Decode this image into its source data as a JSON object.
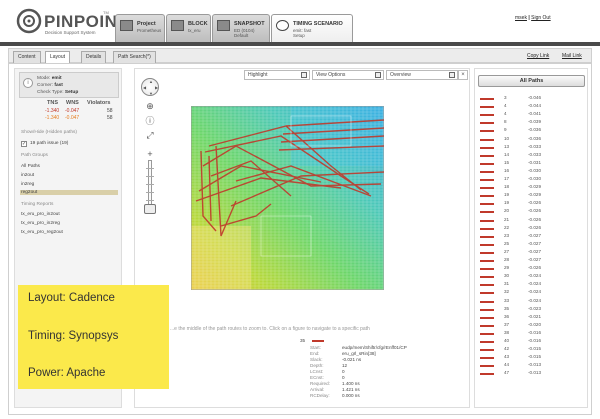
{
  "header": {
    "brand": "PINPOINT",
    "brand_tm": "TM",
    "tagline": "Decision Support System",
    "user": "msek",
    "separator": "|",
    "sign_out": "Sign Out",
    "crumbs": {
      "project": {
        "title": "Project",
        "sub": "Prometheus"
      },
      "block": {
        "title": "BLOCK",
        "sub": "tx_eru"
      },
      "snapshot": {
        "title": "SNAPSHOT",
        "sub": "ED (0104)",
        "sub2": "Default"
      },
      "timing": {
        "title": "TIMING SCENARIO",
        "sub": "emit: fast",
        "sub2": "Setup"
      }
    }
  },
  "tabs": [
    "Content",
    "Layout",
    "Details",
    "Path Search(*)"
  ],
  "active_tab": "Layout",
  "links": {
    "copy": "Copy Link",
    "mail": "Mail Link"
  },
  "left": {
    "mode": {
      "mode_label": "Mode:",
      "mode_value": "emit",
      "corner_label": "Corner:",
      "corner_value": "fast",
      "check_label": "Check Type:",
      "check_value": "Setup"
    },
    "metrics": {
      "headers": [
        "TNS",
        "WNS",
        "Violators"
      ],
      "rows": [
        [
          "-1.340",
          "-0.047",
          "58"
        ],
        [
          "-1.340",
          "-0.047",
          "58"
        ]
      ]
    },
    "hidden_label": "Show/Hide (Hidden paths)",
    "path_issue": "19 path issue (19)",
    "path_groups_label": "Path Groups",
    "path_groups": [
      "All Paths",
      "in2out",
      "in2reg",
      "reg2out"
    ],
    "selected_group": "reg2out",
    "timing_reports_label": "Timing Reports",
    "timing_reports": [
      "tx_eru_pro_in2out",
      "tx_eru_pro_in2reg",
      "tx_eru_pro_reg2out"
    ]
  },
  "overlay": {
    "lines": [
      "Layout: Cadence",
      "Timing: Synopsys",
      "Power: Apache"
    ]
  },
  "toolbar": {
    "highlight": "Highlight",
    "view_options": "View Options",
    "overview": "Overview",
    "close": "×"
  },
  "center": {
    "hint": "...e the middle of the path routes to zoom to. Click on a figure to navigate to a specific path",
    "selected_path_num": "35",
    "details": [
      [
        "Start:",
        "eudp/mem/Shiftr/cfg/rEnff01/CP"
      ],
      [
        "End:",
        "eru_grl_sRin[38]"
      ],
      [
        "Slack:",
        "-0.021 ns"
      ],
      [
        "Depth:",
        "12"
      ],
      [
        "LCnst:",
        "0"
      ],
      [
        "ECnst:",
        "0"
      ],
      [
        "Required:",
        "1.400 ns"
      ],
      [
        "Arrival:",
        "1.421 ns"
      ],
      [
        "RCDelay:",
        "0.000 ns"
      ]
    ]
  },
  "right": {
    "all_paths": "All Paths",
    "paths": [
      [
        "3",
        "-0.046"
      ],
      [
        "4",
        "-0.044"
      ],
      [
        "4",
        "-0.041"
      ],
      [
        "8",
        "-0.039"
      ],
      [
        "9",
        "-0.036"
      ],
      [
        "10",
        "-0.036"
      ],
      [
        "13",
        "-0.033"
      ],
      [
        "14",
        "-0.033"
      ],
      [
        "15",
        "-0.031"
      ],
      [
        "16",
        "-0.030"
      ],
      [
        "17",
        "-0.030"
      ],
      [
        "18",
        "-0.029"
      ],
      [
        "19",
        "-0.029"
      ],
      [
        "19",
        "-0.026"
      ],
      [
        "20",
        "-0.026"
      ],
      [
        "21",
        "-0.026"
      ],
      [
        "22",
        "-0.026"
      ],
      [
        "23",
        "-0.027"
      ],
      [
        "25",
        "-0.027"
      ],
      [
        "27",
        "-0.027"
      ],
      [
        "28",
        "-0.027"
      ],
      [
        "29",
        "-0.026"
      ],
      [
        "30",
        "-0.024"
      ],
      [
        "31",
        "-0.024"
      ],
      [
        "32",
        "-0.024"
      ],
      [
        "33",
        "-0.024"
      ],
      [
        "35",
        "-0.023"
      ],
      [
        "36",
        "-0.021"
      ],
      [
        "37",
        "-0.020"
      ],
      [
        "38",
        "-0.016"
      ],
      [
        "40",
        "-0.016"
      ],
      [
        "42",
        "-0.015"
      ],
      [
        "43",
        "-0.015"
      ],
      [
        "44",
        "-0.013"
      ],
      [
        "47",
        "-0.013"
      ]
    ]
  },
  "colors": {
    "path_red": "#c0392b",
    "overlay_yellow": "#fbe94b",
    "header_bar": "#4a4a4a"
  }
}
